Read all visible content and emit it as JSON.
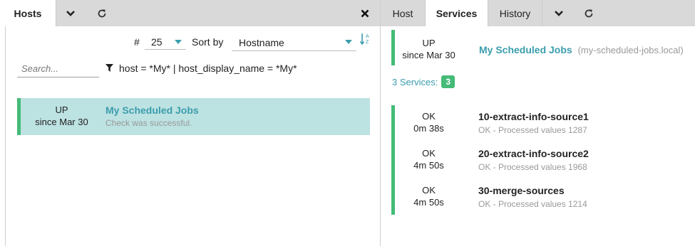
{
  "left_tabs": {
    "hosts_label": "Hosts",
    "dropdown_icon": "chevron-down-icon",
    "refresh_icon": "refresh-icon",
    "close_icon": "close-icon"
  },
  "controls": {
    "hash_label": "#",
    "limit_value": "25",
    "sort_label": "Sort by",
    "sort_value": "Hostname",
    "sort_direction_icon": "sort-alpha-asc-icon"
  },
  "search": {
    "placeholder": "Search..."
  },
  "filter": {
    "icon": "filter-icon",
    "text": "host = *My* | host_display_name = *My*"
  },
  "host_list": [
    {
      "state": "UP",
      "since": "since Mar 30",
      "name": "My Scheduled Jobs",
      "output": "Check was successful."
    }
  ],
  "right_tabs": {
    "host_label": "Host",
    "services_label": "Services",
    "history_label": "History"
  },
  "detail": {
    "state": "UP",
    "since": "since Mar 30",
    "name": "My Scheduled Jobs",
    "fqdn": "(my-scheduled-jobs.local)",
    "services_summary": "3 Services:",
    "services_count": "3"
  },
  "services": [
    {
      "state": "OK",
      "duration": "0m 38s",
      "name": "10-extract-info-source1",
      "output": "OK - Processed values  1287"
    },
    {
      "state": "OK",
      "duration": "4m 50s",
      "name": "20-extract-info-source2",
      "output": "OK - Processed values  1968"
    },
    {
      "state": "OK",
      "duration": "4m 50s",
      "name": "30-merge-sources",
      "output": "OK - Processed values  1214"
    }
  ],
  "colors": {
    "accent": "#3b9dad",
    "ok_green": "#44bb77",
    "selected_row": "#bde2e2",
    "tabbar": "#d9d9d9"
  }
}
